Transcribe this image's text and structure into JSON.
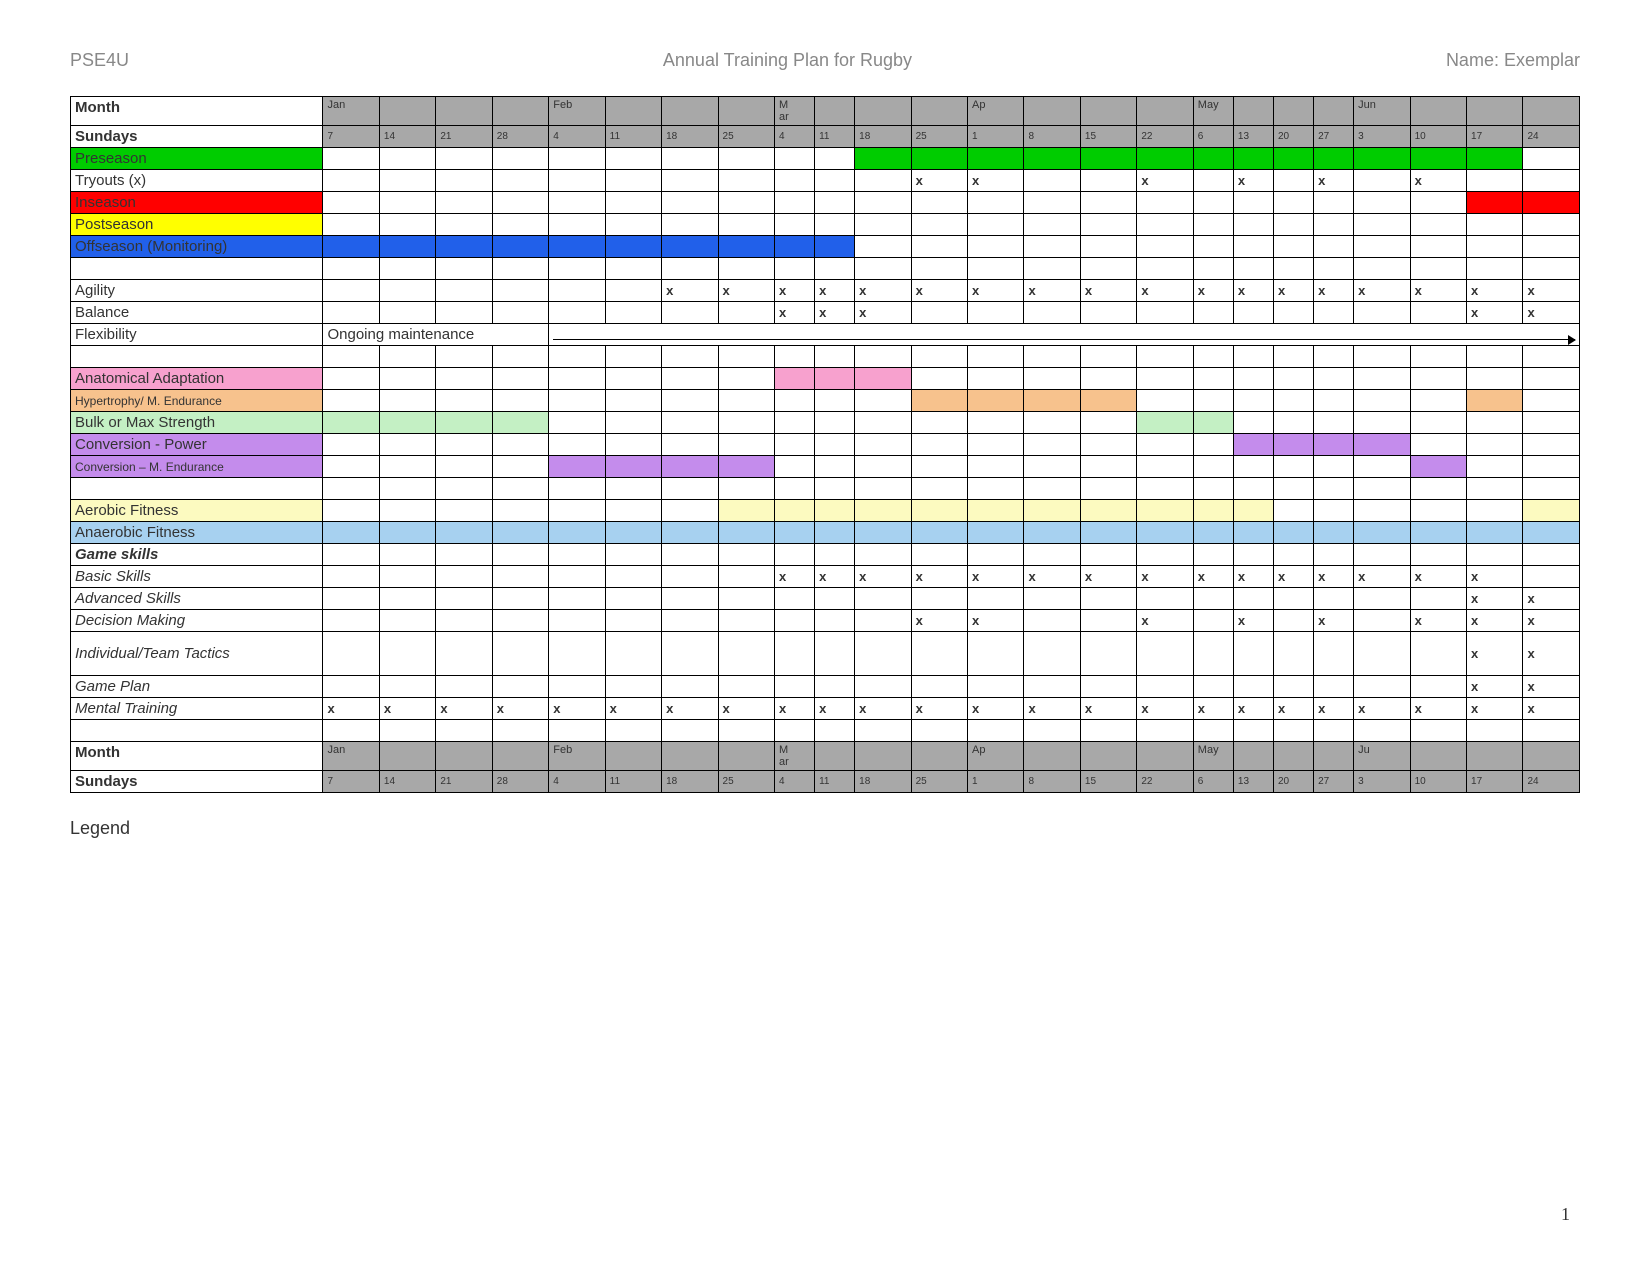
{
  "header": {
    "left": "PSE4U",
    "center": "Annual Training Plan for Rugby",
    "right": "Name: Exemplar"
  },
  "labels": {
    "month": "Month",
    "sundays": "Sundays",
    "preseason": "Preseason",
    "tryouts": "Tryouts (x)",
    "inseason": "Inseason",
    "postseason": "Postseason",
    "offseason": "Offseason (Monitoring)",
    "agility": "Agility",
    "balance": "Balance",
    "flexibility": "Flexibility",
    "ongoing": "Ongoing maintenance",
    "anat": "Anatomical Adaptation",
    "hyper": "Hypertrophy/ M. Endurance",
    "bulk": "Bulk or Max Strength",
    "convp": "Conversion - Power",
    "convm": "Conversion – M. Endurance",
    "aerobic": "Aerobic Fitness",
    "anaerobic": "Anaerobic Fitness",
    "gskills": "Game skills",
    "basic": "Basic Skills",
    "adv": "Advanced Skills",
    "dec": "Decision Making",
    "itt": "Individual/Team Tactics",
    "gplan": "Game Plan",
    "mental": "Mental Training"
  },
  "cols": [
    {
      "m": "Jan",
      "d": "7",
      "k": "w"
    },
    {
      "m": "",
      "d": "14",
      "k": "w"
    },
    {
      "m": "",
      "d": "21",
      "k": "w"
    },
    {
      "m": "",
      "d": "28",
      "k": "w"
    },
    {
      "m": "Feb",
      "d": "4",
      "k": "w"
    },
    {
      "m": "",
      "d": "11",
      "k": "w"
    },
    {
      "m": "",
      "d": "18",
      "k": "w"
    },
    {
      "m": "",
      "d": "25",
      "k": "w"
    },
    {
      "m": "Mar",
      "d": "4",
      "k": "n"
    },
    {
      "m": "",
      "d": "11",
      "k": "n"
    },
    {
      "m": "",
      "d": "18",
      "k": "w"
    },
    {
      "m": "",
      "d": "25",
      "k": "w"
    },
    {
      "m": "Ap",
      "d": "1",
      "k": "w"
    },
    {
      "m": "",
      "d": "8",
      "k": "w"
    },
    {
      "m": "",
      "d": "15",
      "k": "w"
    },
    {
      "m": "",
      "d": "22",
      "k": "w"
    },
    {
      "m": "May",
      "d": "6",
      "k": "n"
    },
    {
      "m": "",
      "d": "13",
      "k": "n"
    },
    {
      "m": "",
      "d": "20",
      "k": "n"
    },
    {
      "m": "",
      "d": "27",
      "k": "n"
    },
    {
      "m": "Jun",
      "d": "3",
      "k": "w"
    },
    {
      "m": "",
      "d": "10",
      "k": "w"
    },
    {
      "m": "",
      "d": "17",
      "k": "w"
    },
    {
      "m": "",
      "d": "24",
      "k": "w"
    }
  ],
  "footer_month_last": "Ju",
  "rows": {
    "preseason": {
      "color": "green",
      "fills": [
        10,
        11,
        12,
        13,
        14,
        15,
        16,
        17,
        18,
        19,
        20,
        21,
        22
      ]
    },
    "tryouts": {
      "x": [
        11,
        12,
        15,
        17,
        19,
        21
      ]
    },
    "inseason": {
      "color": "red",
      "fills": [
        22,
        23
      ]
    },
    "postseason": {
      "color": "yellow",
      "fills": []
    },
    "offseason": {
      "color": "blue",
      "fills": [
        0,
        1,
        2,
        3,
        4,
        5,
        6,
        7,
        8,
        9
      ]
    },
    "agility": {
      "x": [
        6,
        7,
        8,
        9,
        10,
        11,
        12,
        13,
        14,
        15,
        16,
        17,
        18,
        19,
        20,
        21,
        22,
        23
      ]
    },
    "balance": {
      "x": [
        8,
        9,
        10,
        22,
        23
      ]
    },
    "anat": {
      "color": "pink",
      "fills": [
        8,
        9,
        10
      ]
    },
    "hyper": {
      "color": "peach",
      "fills": [
        11,
        12,
        13,
        14,
        22
      ]
    },
    "bulk": {
      "color": "mint",
      "fills": [
        0,
        1,
        2,
        3,
        15,
        16
      ]
    },
    "convp": {
      "color": "purple",
      "fills": [
        17,
        18,
        19,
        20
      ]
    },
    "convm": {
      "color": "lpurple",
      "fills": [
        4,
        5,
        6,
        7,
        21
      ]
    },
    "aerobic": {
      "color": "lyellow",
      "fills": [
        7,
        8,
        9,
        10,
        11,
        12,
        13,
        14,
        15,
        16,
        17,
        23
      ]
    },
    "anaerobic": {
      "color": "lblue",
      "fills": [
        0,
        1,
        2,
        3,
        4,
        5,
        6,
        7,
        8,
        9,
        10,
        11,
        12,
        13,
        14,
        15,
        16,
        17,
        18,
        19,
        20,
        21,
        22,
        23
      ]
    },
    "basic": {
      "x": [
        8,
        9,
        10,
        11,
        12,
        13,
        14,
        15,
        16,
        17,
        18,
        19,
        20,
        21,
        22
      ]
    },
    "adv": {
      "x": [
        22,
        23
      ]
    },
    "dec": {
      "x": [
        11,
        12,
        15,
        17,
        19,
        21,
        22,
        23
      ]
    },
    "itt": {
      "x": [
        22,
        23
      ]
    },
    "gplan": {
      "x": [
        22,
        23
      ]
    },
    "mental": {
      "x": [
        0,
        1,
        2,
        3,
        4,
        5,
        6,
        7,
        8,
        9,
        10,
        11,
        12,
        13,
        14,
        15,
        16,
        17,
        18,
        19,
        20,
        21,
        22,
        23
      ]
    }
  },
  "legend": "Legend",
  "pagenum": "1"
}
